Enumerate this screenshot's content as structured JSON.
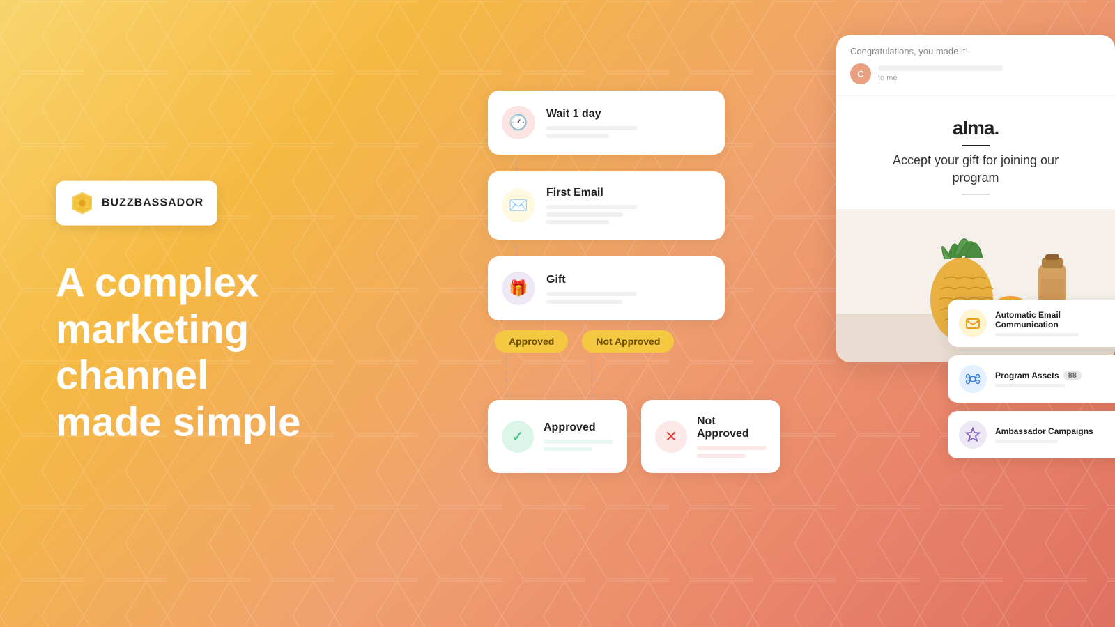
{
  "background": {
    "gradient_start": "#f9d56e",
    "gradient_end": "#e07060"
  },
  "logo": {
    "text_buzz": "BUZZ",
    "text_bassador": "BASSADOR",
    "full_text": "BUZZBASSADOR"
  },
  "hero": {
    "line1": "A complex",
    "line2": "marketing channel",
    "line3": "made simple"
  },
  "flow_cards": [
    {
      "id": "wait",
      "title": "Wait 1 day",
      "icon": "🕐",
      "icon_bg": "pink"
    },
    {
      "id": "email",
      "title": "First Email",
      "icon": "✉️",
      "icon_bg": "yellow"
    },
    {
      "id": "gift",
      "title": "Gift",
      "icon": "🎁",
      "icon_bg": "purple"
    }
  ],
  "badges": {
    "approved": "Approved",
    "not_approved": "Not Approved"
  },
  "outcomes": [
    {
      "id": "approved",
      "title": "Approved",
      "icon": "✓",
      "icon_bg": "green"
    },
    {
      "id": "not_approved",
      "title": "Not Approved",
      "icon": "✕",
      "icon_bg": "red"
    }
  ],
  "email_preview": {
    "subject": "Congratulations, you made it!",
    "sender_initial": "C",
    "sender_to": "to me",
    "brand_name": "alma.",
    "copy": "Accept your gift for joining our program"
  },
  "right_cards": [
    {
      "id": "auto-email",
      "title": "Automatic Email Communication",
      "icon": "💬",
      "icon_bg": "yellow"
    },
    {
      "id": "program-assets",
      "title": "Program Assets",
      "badge": "88",
      "icon": "⚙",
      "icon_bg": "blue"
    },
    {
      "id": "ambassador-campaigns",
      "title": "Ambassador Campaigns",
      "icon": "⭐",
      "icon_bg": "purple"
    }
  ]
}
